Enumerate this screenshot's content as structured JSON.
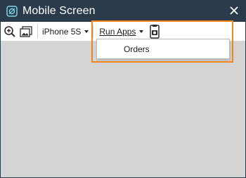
{
  "window": {
    "title": "Mobile Screen"
  },
  "toolbar": {
    "device": "iPhone 5S",
    "run_apps": "Run Apps"
  },
  "menu": {
    "items": [
      {
        "label": "Orders"
      }
    ]
  },
  "colors": {
    "titlebar": "#2b3b4c",
    "highlight": "#f0861b",
    "background": "#d4d4d4"
  },
  "icons": {
    "app": "app-icon",
    "close": "close-icon",
    "zoom": "zoom-in-icon",
    "image": "image-icon",
    "camera": "camera-icon"
  }
}
